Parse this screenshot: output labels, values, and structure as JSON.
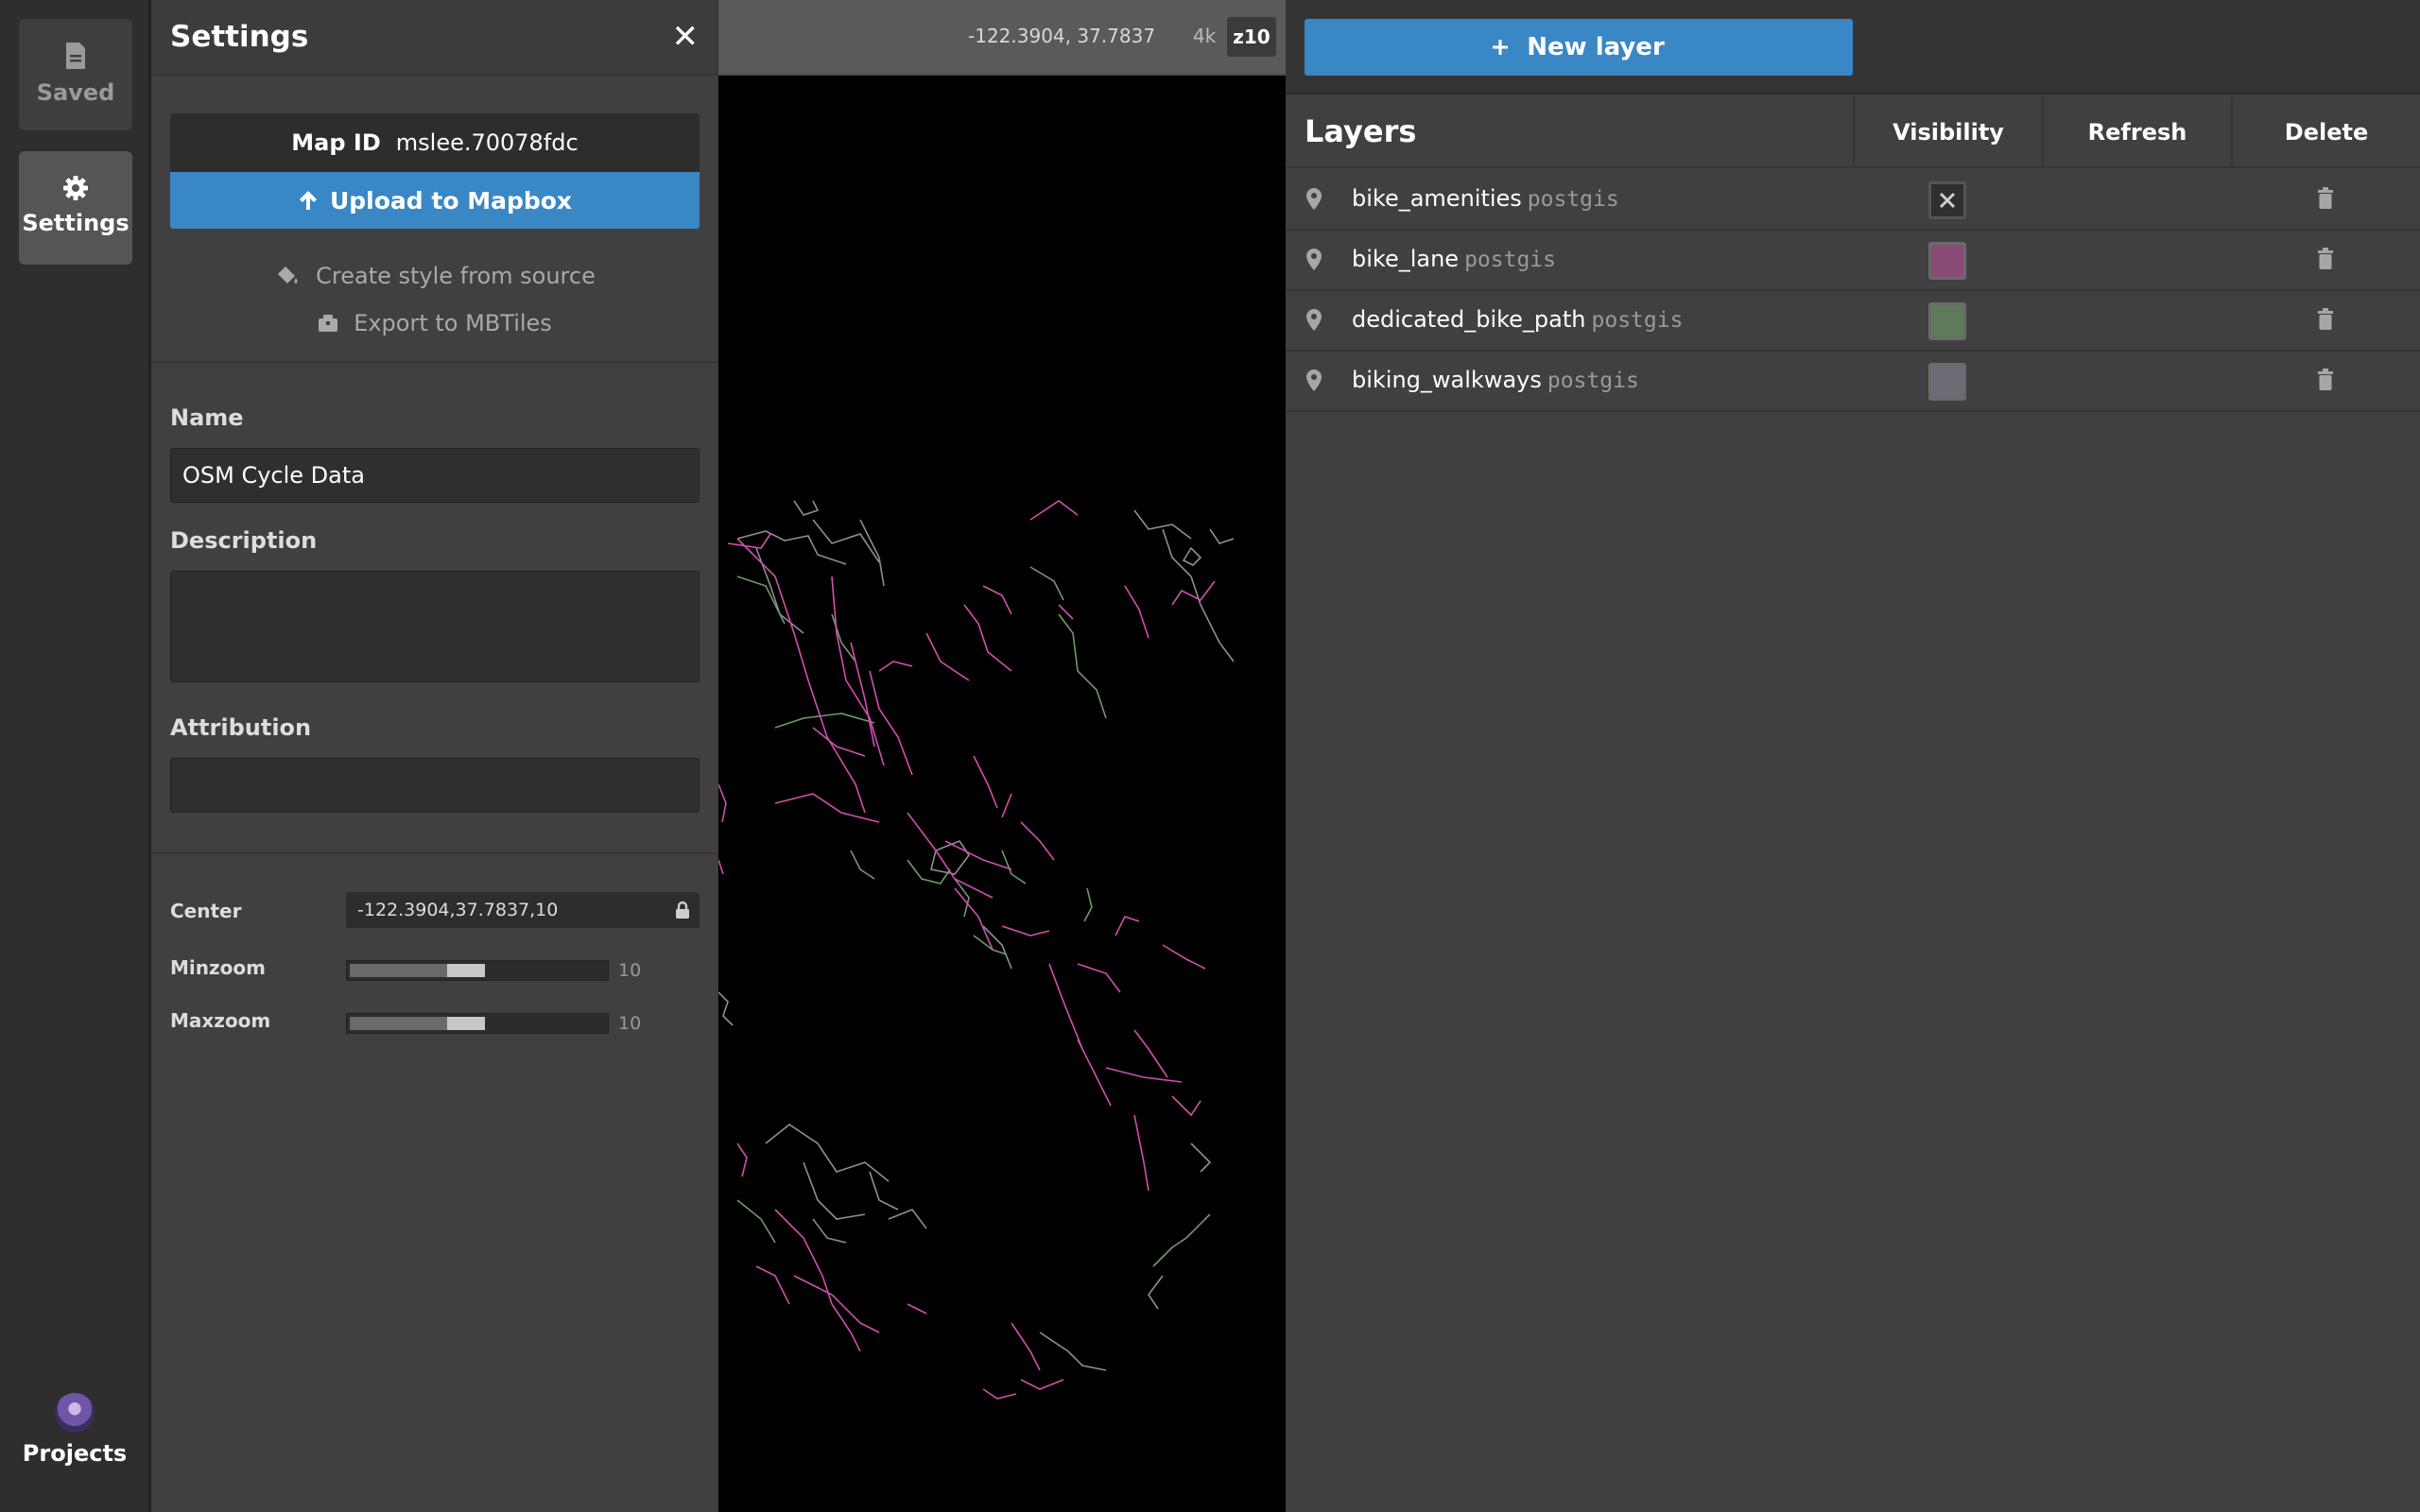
{
  "nav": {
    "saved_label": "Saved",
    "settings_label": "Settings",
    "projects_label": "Projects"
  },
  "settings": {
    "title": "Settings",
    "map_id_label": "Map ID",
    "map_id_value": "mslee.70078fdc",
    "upload_label": "Upload to Mapbox",
    "create_style_label": "Create style from source",
    "export_label": "Export to MBTiles",
    "name_label": "Name",
    "name_value": "OSM Cycle Data",
    "description_label": "Description",
    "description_value": "",
    "attribution_label": "Attribution",
    "attribution_value": "",
    "center_label": "Center",
    "center_value": "-122.3904,37.7837,10",
    "minzoom_label": "Minzoom",
    "minzoom_value": "10",
    "maxzoom_label": "Maxzoom",
    "maxzoom_value": "10"
  },
  "map": {
    "coords": "-122.3904, 37.7837",
    "resolution": "4k",
    "zoom": "z10"
  },
  "layers": {
    "new_layer_label": "New layer",
    "title": "Layers",
    "col_visibility": "Visibility",
    "col_refresh": "Refresh",
    "col_delete": "Delete",
    "items": [
      {
        "name": "bike_amenities",
        "source": "postgis",
        "color": "#2f2f2f",
        "hidden": true
      },
      {
        "name": "bike_lane",
        "source": "postgis",
        "color": "#8a4a78",
        "hidden": false
      },
      {
        "name": "dedicated_bike_path",
        "source": "postgis",
        "color": "#5e7a5a",
        "hidden": false
      },
      {
        "name": "biking_walkways",
        "source": "postgis",
        "color": "#6c6c74",
        "hidden": false
      }
    ]
  },
  "colors": {
    "accent": "#3a87c6",
    "bike_lane": "#d24fb0",
    "bike_path": "#6f9b68",
    "walkway": "#9a9aa4"
  }
}
